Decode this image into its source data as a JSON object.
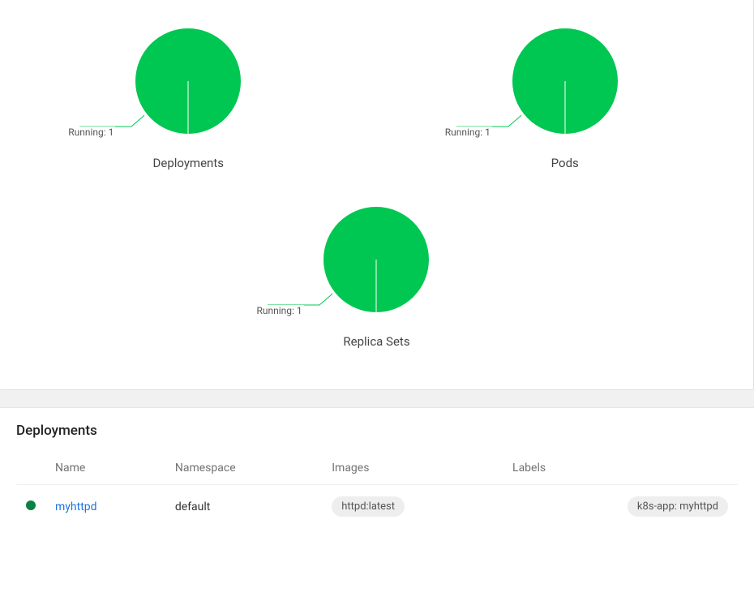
{
  "workload_status": {
    "charts": [
      {
        "title": "Deployments",
        "label": "Running: 1"
      },
      {
        "title": "Pods",
        "label": "Running: 1"
      },
      {
        "title": "Replica Sets",
        "label": "Running: 1"
      }
    ]
  },
  "deployments_section": {
    "title": "Deployments",
    "columns": {
      "name": "Name",
      "namespace": "Namespace",
      "images": "Images",
      "labels": "Labels"
    },
    "rows": [
      {
        "status": "running",
        "name": "myhttpd",
        "namespace": "default",
        "image": "httpd:latest",
        "label": "k8s-app: myhttpd"
      }
    ]
  },
  "chart_data": [
    {
      "type": "pie",
      "title": "Deployments",
      "series": [
        {
          "name": "Running",
          "value": 1
        }
      ],
      "total": 1
    },
    {
      "type": "pie",
      "title": "Pods",
      "series": [
        {
          "name": "Running",
          "value": 1
        }
      ],
      "total": 1
    },
    {
      "type": "pie",
      "title": "Replica Sets",
      "series": [
        {
          "name": "Running",
          "value": 1
        }
      ],
      "total": 1
    }
  ],
  "colors": {
    "running": "#00c752",
    "status_dot": "#0b8043",
    "link": "#1a73e8"
  }
}
